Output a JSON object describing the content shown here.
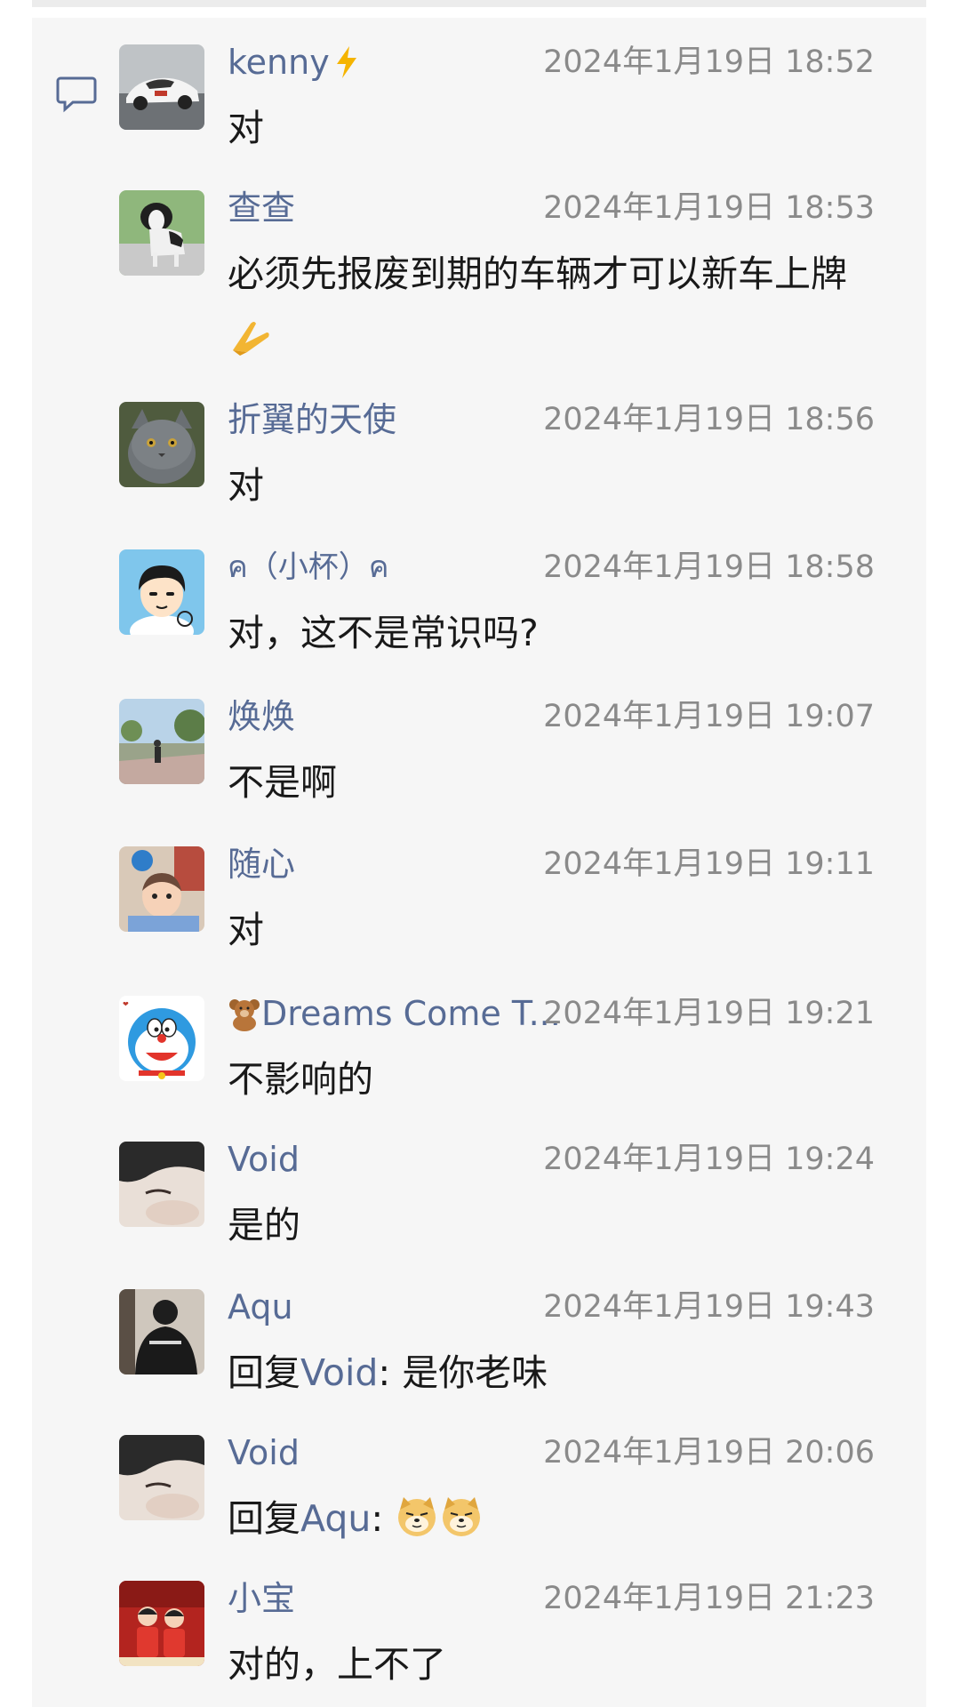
{
  "comments": [
    {
      "name": "kenny",
      "name_suffix_icon": "lightning-icon",
      "time": "2024年1月19日 18:52",
      "text": "对",
      "avatar": "car-photo-avatar"
    },
    {
      "name": "查查",
      "time": "2024年1月19日 18:53",
      "text": "必须先报废到期的车辆才可以新车上牌",
      "text_suffix_icon": "praying-hands-emoji",
      "avatar": "dog-photo-avatar"
    },
    {
      "name": "折翼的天使",
      "time": "2024年1月19日 18:56",
      "text": "对",
      "avatar": "cat-photo-avatar"
    },
    {
      "name": "ค（小杯）ค",
      "time": "2024年1月19日 18:58",
      "text": "对，这不是常识吗?",
      "avatar": "cartoon-boy-avatar"
    },
    {
      "name": "焕焕",
      "time": "2024年1月19日 19:07",
      "text": "不是啊",
      "avatar": "street-photo-avatar"
    },
    {
      "name": "随心",
      "time": "2024年1月19日 19:11",
      "text": "对",
      "avatar": "baby-photo-avatar"
    },
    {
      "name": "Dreams Come T...",
      "name_prefix_icon": "teddy-bear-icon",
      "time": "2024年1月19日 19:21",
      "text": "不影响的",
      "avatar": "doraemon-avatar"
    },
    {
      "name": "Void",
      "time": "2024年1月19日 19:24",
      "text": "是的",
      "avatar": "face-closeup-avatar"
    },
    {
      "name": "Aqu",
      "time": "2024年1月19日 19:43",
      "text_prefix": "回复",
      "reply_to": "Void",
      "text": ": 是你老味",
      "avatar": "man-back-avatar"
    },
    {
      "name": "Void",
      "time": "2024年1月19日 20:06",
      "text_prefix": "回复",
      "reply_to": "Aqu",
      "text": ": ",
      "text_suffix_icons": [
        "doge-emoji",
        "doge-emoji"
      ],
      "avatar": "face-closeup-avatar"
    },
    {
      "name": "小宝",
      "time": "2024年1月19日 21:23",
      "text": "对的，上不了",
      "avatar": "kids-red-avatar"
    }
  ],
  "colors": {
    "name": "#576b95",
    "time": "#8a8a8a",
    "text": "#191919",
    "panel": "#f6f6f6"
  },
  "icons": {
    "comment": "comment-bubble-icon"
  }
}
